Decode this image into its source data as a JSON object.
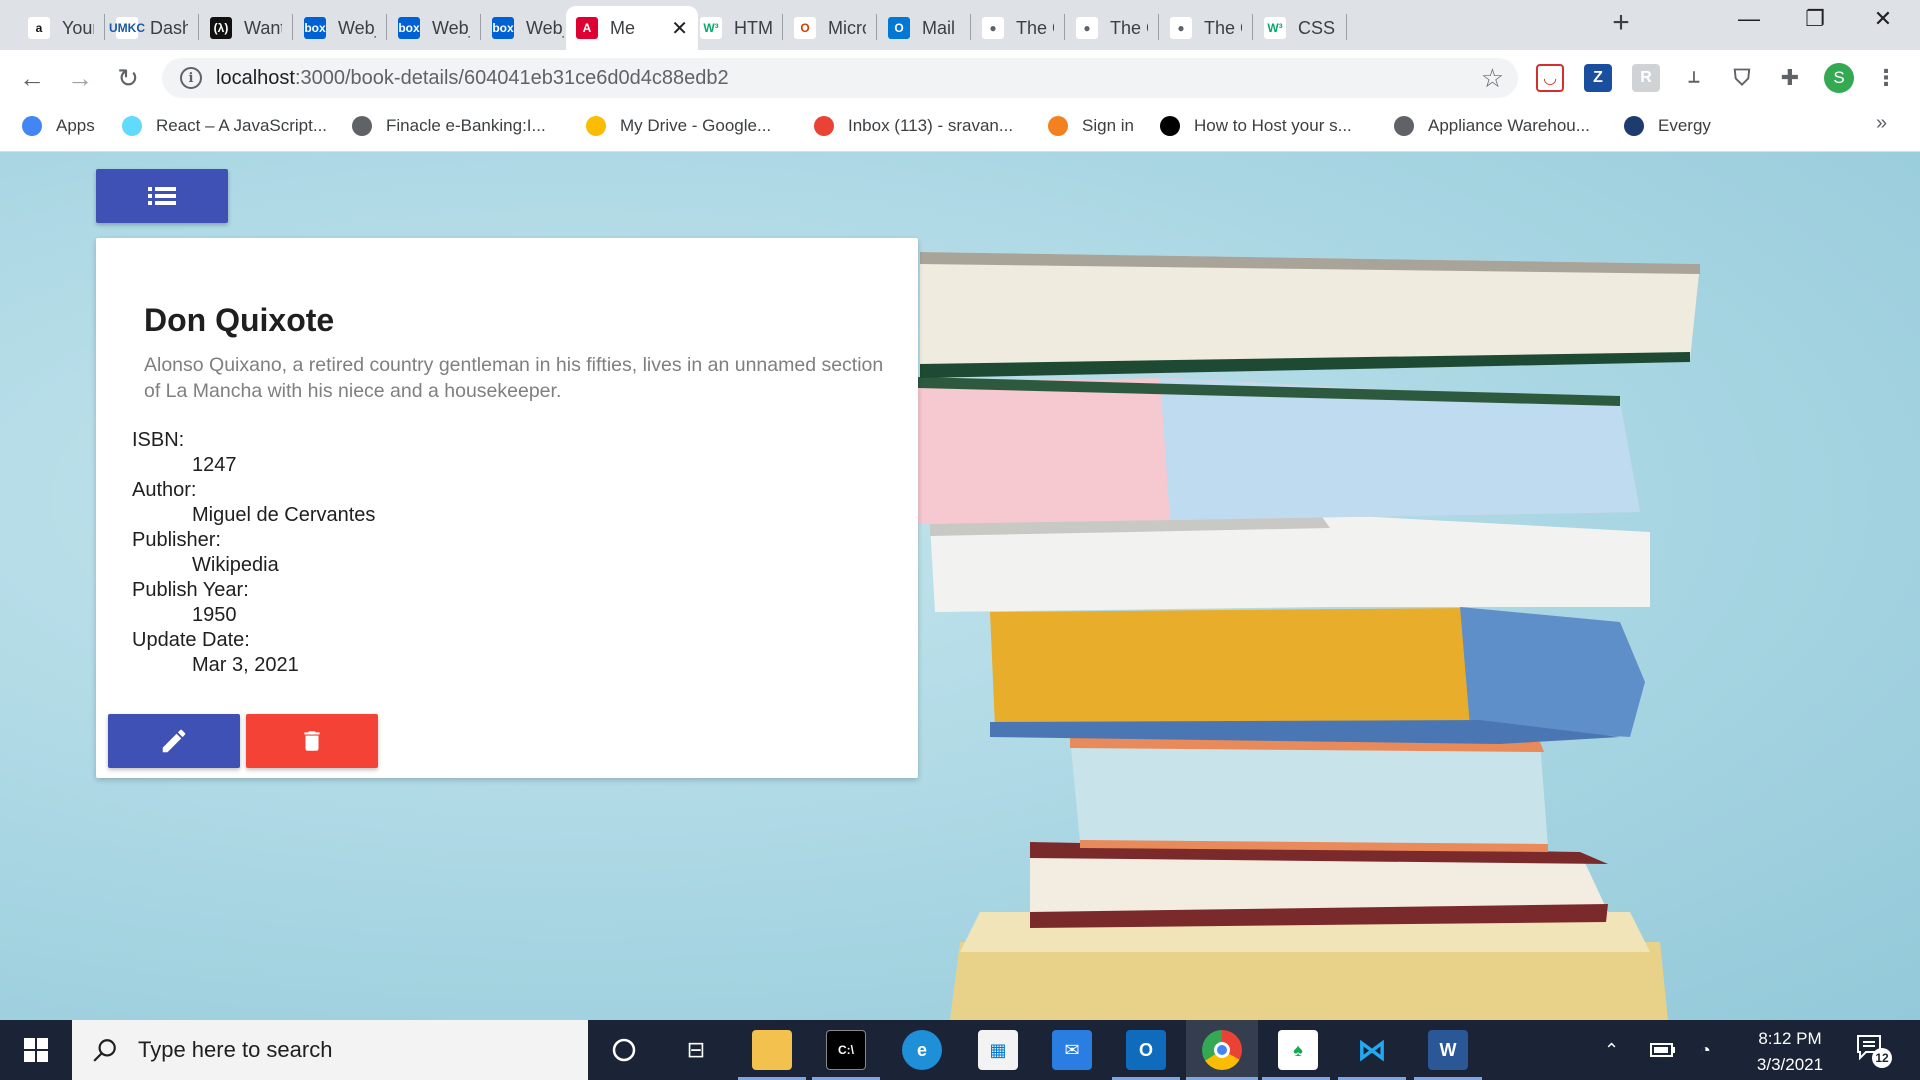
{
  "browser": {
    "tabs": [
      {
        "title": "Your O",
        "favicon": "amazon-icon",
        "fav_text": "a",
        "fav_bg": "#ffffff",
        "fav_color": "#111111"
      },
      {
        "title": "Dashb",
        "favicon": "umkc-icon",
        "fav_text": "UMKC",
        "fav_bg": "#ffffff",
        "fav_color": "#1a57a6"
      },
      {
        "title": "Want t",
        "favicon": "code-icon",
        "fav_text": "(λ)",
        "fav_bg": "#111111",
        "fav_color": "#ffffff"
      },
      {
        "title": "Web_L",
        "favicon": "box-icon",
        "fav_text": "box",
        "fav_bg": "#0061d5",
        "fav_color": "#ffffff"
      },
      {
        "title": "Web_L",
        "favicon": "box-icon",
        "fav_text": "box",
        "fav_bg": "#0061d5",
        "fav_color": "#ffffff"
      },
      {
        "title": "Web_L",
        "favicon": "box-icon",
        "fav_text": "box",
        "fav_bg": "#0061d5",
        "fav_color": "#ffffff"
      },
      {
        "title": "Me",
        "favicon": "angular-icon",
        "fav_text": "A",
        "fav_bg": "#dd0031",
        "fav_color": "#ffffff",
        "active": true
      },
      {
        "title": "HTML",
        "favicon": "w3schools-icon",
        "fav_text": "W³",
        "fav_bg": "#ffffff",
        "fav_color": "#04aa6d"
      },
      {
        "title": "Micros",
        "favicon": "office-icon",
        "fav_text": "O",
        "fav_bg": "#ffffff",
        "fav_color": "#d83b01"
      },
      {
        "title": "Mail -",
        "favicon": "outlook-icon",
        "fav_text": "O",
        "fav_bg": "#0078d4",
        "fav_color": "#ffffff"
      },
      {
        "title": "The Gr",
        "favicon": "globe-icon",
        "fav_text": "●",
        "fav_bg": "#ffffff",
        "fav_color": "#5f6368"
      },
      {
        "title": "The Gr",
        "favicon": "globe-icon",
        "fav_text": "●",
        "fav_bg": "#ffffff",
        "fav_color": "#5f6368"
      },
      {
        "title": "The Gr",
        "favicon": "globe-icon",
        "fav_text": "●",
        "fav_bg": "#ffffff",
        "fav_color": "#5f6368"
      },
      {
        "title": "CSS b",
        "favicon": "w3schools-icon",
        "fav_text": "W³",
        "fav_bg": "#ffffff",
        "fav_color": "#04aa6d"
      }
    ],
    "url_host": "localhost",
    "url_path": ":3000/book-details/604041eb31ce6d0d4c88edb2",
    "profile_initial": "S",
    "bookmarks": [
      {
        "label": "Apps",
        "icon": "apps-grid-icon",
        "color": "#4285f4"
      },
      {
        "label": "React – A JavaScript...",
        "icon": "react-icon",
        "color": "#61dafb"
      },
      {
        "label": "Finacle e-Banking:I...",
        "icon": "globe-icon",
        "color": "#5f6368"
      },
      {
        "label": "My Drive - Google...",
        "icon": "google-drive-icon",
        "color": "#fbbc04"
      },
      {
        "label": "Inbox (113) - sravan...",
        "icon": "gmail-icon",
        "color": "#ea4335"
      },
      {
        "label": "Sign in",
        "icon": "sign-in-icon",
        "color": "#f4811f"
      },
      {
        "label": "How to Host your s...",
        "icon": "dev-icon",
        "color": "#000000"
      },
      {
        "label": "Appliance Warehou...",
        "icon": "globe-icon",
        "color": "#5f6368"
      },
      {
        "label": "Evergy",
        "icon": "evergy-icon",
        "color": "#1d3b6f"
      }
    ],
    "bookmarks_more": "»"
  },
  "book": {
    "title": "Don Quixote",
    "description": "Alonso Quixano, a retired country gentleman in his fifties, lives in an unnamed section of La Mancha with his niece and a housekeeper.",
    "fields": [
      {
        "label": "ISBN:",
        "value": "1247"
      },
      {
        "label": "Author:",
        "value": "Miguel de Cervantes"
      },
      {
        "label": "Publisher:",
        "value": "Wikipedia"
      },
      {
        "label": "Publish Year:",
        "value": "1950"
      },
      {
        "label": "Update Date:",
        "value": "Mar 3, 2021"
      }
    ]
  },
  "colors": {
    "primary": "#3f51b5",
    "danger": "#f44336"
  },
  "taskbar": {
    "search_placeholder": "Type here to search",
    "time": "8:12 PM",
    "date": "3/3/2021",
    "notification_count": "12"
  }
}
